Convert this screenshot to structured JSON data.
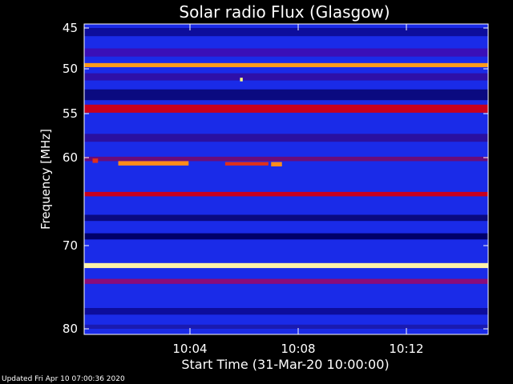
{
  "chart_data": {
    "type": "heatmap",
    "title": "Solar radio Flux (Glasgow)",
    "xlabel": "Start Time (31-Mar-20 10:00:00)",
    "ylabel": "Frequency [MHz]",
    "x_unit": "minutes after 10:00:00",
    "xlim": [
      0,
      15.4
    ],
    "ylim": [
      45,
      80
    ],
    "y_ticks": [
      45,
      50,
      55,
      60,
      70,
      80
    ],
    "x_ticks": [
      {
        "value": 4,
        "label": "10:04"
      },
      {
        "value": 8,
        "label": "10:08"
      },
      {
        "value": 12,
        "label": "10:12"
      }
    ],
    "background_color": "#1a2be8",
    "bands": [
      {
        "freq_start": 45.0,
        "freq_end": 46.0,
        "color": "#0d0d9c"
      },
      {
        "freq_start": 47.5,
        "freq_end": 48.5,
        "color": "#3a0fb8"
      },
      {
        "freq_start": 49.3,
        "freq_end": 49.8,
        "color": "#ff9c1a"
      },
      {
        "freq_start": 50.5,
        "freq_end": 51.3,
        "color": "#2e10a8"
      },
      {
        "freq_start": 52.3,
        "freq_end": 53.5,
        "color": "#0a0a80"
      },
      {
        "freq_start": 54.0,
        "freq_end": 54.9,
        "color": "#c8001e"
      },
      {
        "freq_start": 57.3,
        "freq_end": 58.2,
        "color": "#2a10a0"
      },
      {
        "freq_start": 59.9,
        "freq_end": 60.4,
        "color": "#6a0c7a"
      },
      {
        "freq_start": 63.9,
        "freq_end": 64.4,
        "color": "#c8001e"
      },
      {
        "freq_start": 66.5,
        "freq_end": 67.2,
        "color": "#0a0a80"
      },
      {
        "freq_start": 68.6,
        "freq_end": 69.3,
        "color": "#00006a"
      },
      {
        "freq_start": 72.1,
        "freq_end": 72.7,
        "color": "#fff2a8"
      },
      {
        "freq_start": 74.0,
        "freq_end": 74.6,
        "color": "#8a0c7a"
      },
      {
        "freq_start": 77.5,
        "freq_end": 78.3,
        "color": "#0d0d9c"
      },
      {
        "freq_start": 79.5,
        "freq_end": 80.0,
        "color": "#1a1ab0"
      }
    ],
    "bursts": [
      {
        "freq_start": 60.4,
        "freq_end": 60.9,
        "time_start": 1.35,
        "time_end": 3.95,
        "color": "#ff8c1a"
      },
      {
        "freq_start": 60.5,
        "freq_end": 60.9,
        "time_start": 5.3,
        "time_end": 6.9,
        "color": "#e0301a"
      },
      {
        "freq_start": 60.5,
        "freq_end": 61.0,
        "time_start": 7.0,
        "time_end": 7.4,
        "color": "#ff8c1a"
      },
      {
        "freq_start": 60.1,
        "freq_end": 60.6,
        "time_start": 0.4,
        "time_end": 0.6,
        "color": "#e0301a"
      },
      {
        "freq_start": 51.0,
        "freq_end": 51.4,
        "time_start": 5.85,
        "time_end": 5.95,
        "color": "#ffff80"
      }
    ]
  },
  "footer_text": "Updated Fri Apr 10 07:00:36 2020"
}
